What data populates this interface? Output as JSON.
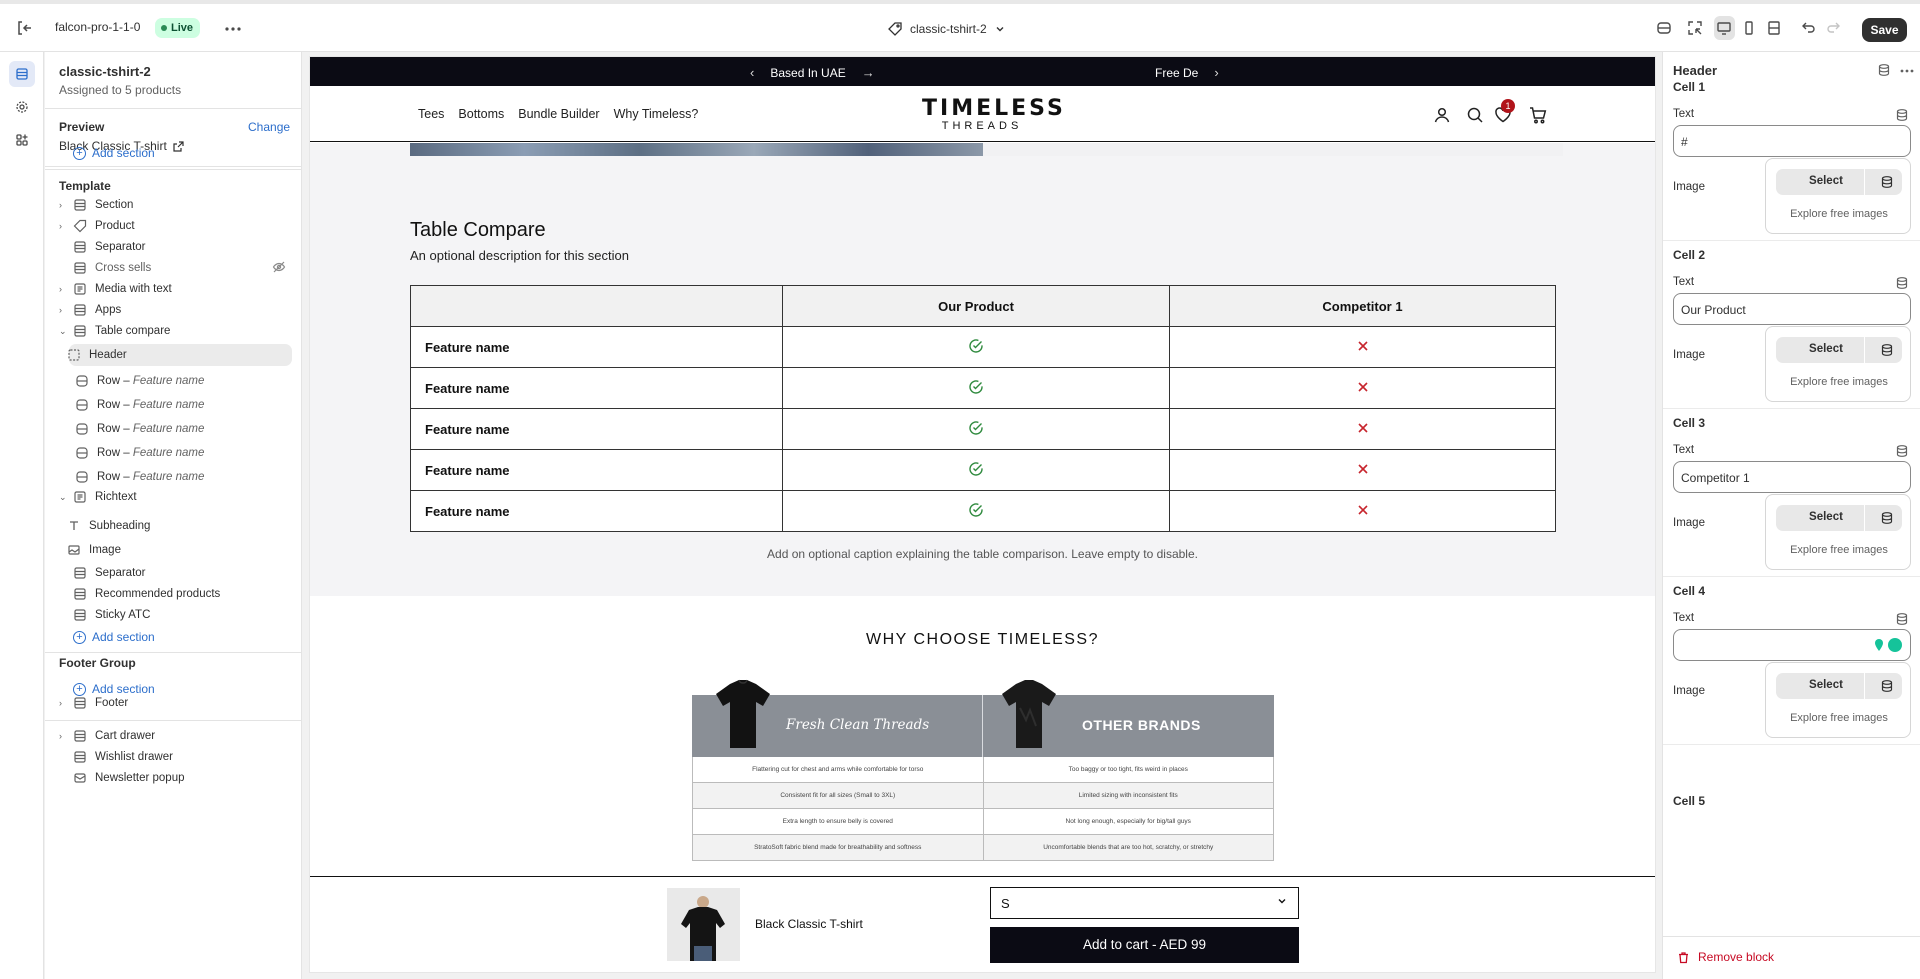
{
  "topbar": {
    "store_name": "falcon-pro-1-1-0",
    "live_badge": "Live",
    "template_name": "classic-tshirt-2",
    "save_label": "Save"
  },
  "left": {
    "template_title": "classic-tshirt-2",
    "assigned": "Assigned to 5 products",
    "preview_label": "Preview",
    "change_label": "Change",
    "preview_product": "Black Classic T-shirt",
    "add_section": "Add section",
    "template_group": "Template",
    "tree": [
      {
        "label": "Section",
        "row": ""
      },
      {
        "label": "Product",
        "row": ""
      },
      {
        "label": "Separator",
        "row": ""
      },
      {
        "label": "Cross sells",
        "row": ""
      },
      {
        "label": "Media with text",
        "row": ""
      },
      {
        "label": "Apps",
        "row": ""
      },
      {
        "label": "Table compare",
        "row": ""
      },
      {
        "label": "Header",
        "row": ""
      },
      {
        "label": "Row –",
        "row": "Feature name"
      },
      {
        "label": "Row –",
        "row": "Feature name"
      },
      {
        "label": "Row –",
        "row": "Feature name"
      },
      {
        "label": "Row –",
        "row": "Feature name"
      },
      {
        "label": "Row –",
        "row": "Feature name"
      },
      {
        "label": "Richtext",
        "row": ""
      },
      {
        "label": "Subheading",
        "row": ""
      },
      {
        "label": "Image",
        "row": ""
      },
      {
        "label": "Separator",
        "row": ""
      },
      {
        "label": "Recommended products",
        "row": ""
      },
      {
        "label": "Sticky ATC",
        "row": ""
      }
    ],
    "footer_group": "Footer Group",
    "footer_item": "Footer",
    "overlay_items": [
      "Cart drawer",
      "Wishlist drawer",
      "Newsletter popup"
    ]
  },
  "preview": {
    "announce": [
      "Based In UAE",
      "Free De"
    ],
    "nav_links": [
      "Tees",
      "Bottoms",
      "Bundle Builder",
      "Why Timeless?"
    ],
    "logo_top": "TIMELESS",
    "logo_bottom": "THREADS",
    "cart_count": "1",
    "table_compare": {
      "heading": "Table Compare",
      "description": "An optional description for this section",
      "columns": [
        "",
        "Our Product",
        "Competitor 1"
      ],
      "rows": [
        "Feature name",
        "Feature name",
        "Feature name",
        "Feature name",
        "Feature name"
      ],
      "caption": "Add on optional caption explaining the table comparison. Leave empty to disable."
    },
    "why": {
      "title": "WHY CHOOSE TIMELESS?",
      "left_head": "Fresh Clean Threads",
      "right_head": "OTHER BRANDS",
      "rows": [
        [
          "Flattering cut for chest and arms while comfortable for torso",
          "Too baggy or too tight, fits weird in places"
        ],
        [
          "Consistent fit for all sizes\n(Small to 3XL)",
          "Limited sizing with inconsistent fits"
        ],
        [
          "Extra length to ensure belly is covered",
          "Not long enough, especially for big/tall guys"
        ],
        [
          "StratoSoft fabric blend made for breathability and softness",
          "Uncomfortable blends that are too hot, scratchy, or stretchy"
        ]
      ]
    },
    "sticky": {
      "product_name": "Black Classic T-shirt",
      "size": "S",
      "add_to_cart": "Add to cart - AED 99"
    }
  },
  "right": {
    "title": "Header",
    "cells": [
      {
        "heading": "Cell 1",
        "text_label": "Text",
        "text_value": "#",
        "image_label": "Image",
        "select": "Select",
        "explore": "Explore free images"
      },
      {
        "heading": "Cell 2",
        "text_label": "Text",
        "text_value": "Our Product",
        "image_label": "Image",
        "select": "Select",
        "explore": "Explore free images"
      },
      {
        "heading": "Cell 3",
        "text_label": "Text",
        "text_value": "Competitor 1",
        "image_label": "Image",
        "select": "Select",
        "explore": "Explore free images"
      },
      {
        "heading": "Cell 4",
        "text_label": "Text",
        "text_value": "",
        "image_label": "Image",
        "select": "Select",
        "explore": "Explore free images"
      }
    ],
    "cell5_heading": "Cell 5",
    "remove_block": "Remove block"
  }
}
